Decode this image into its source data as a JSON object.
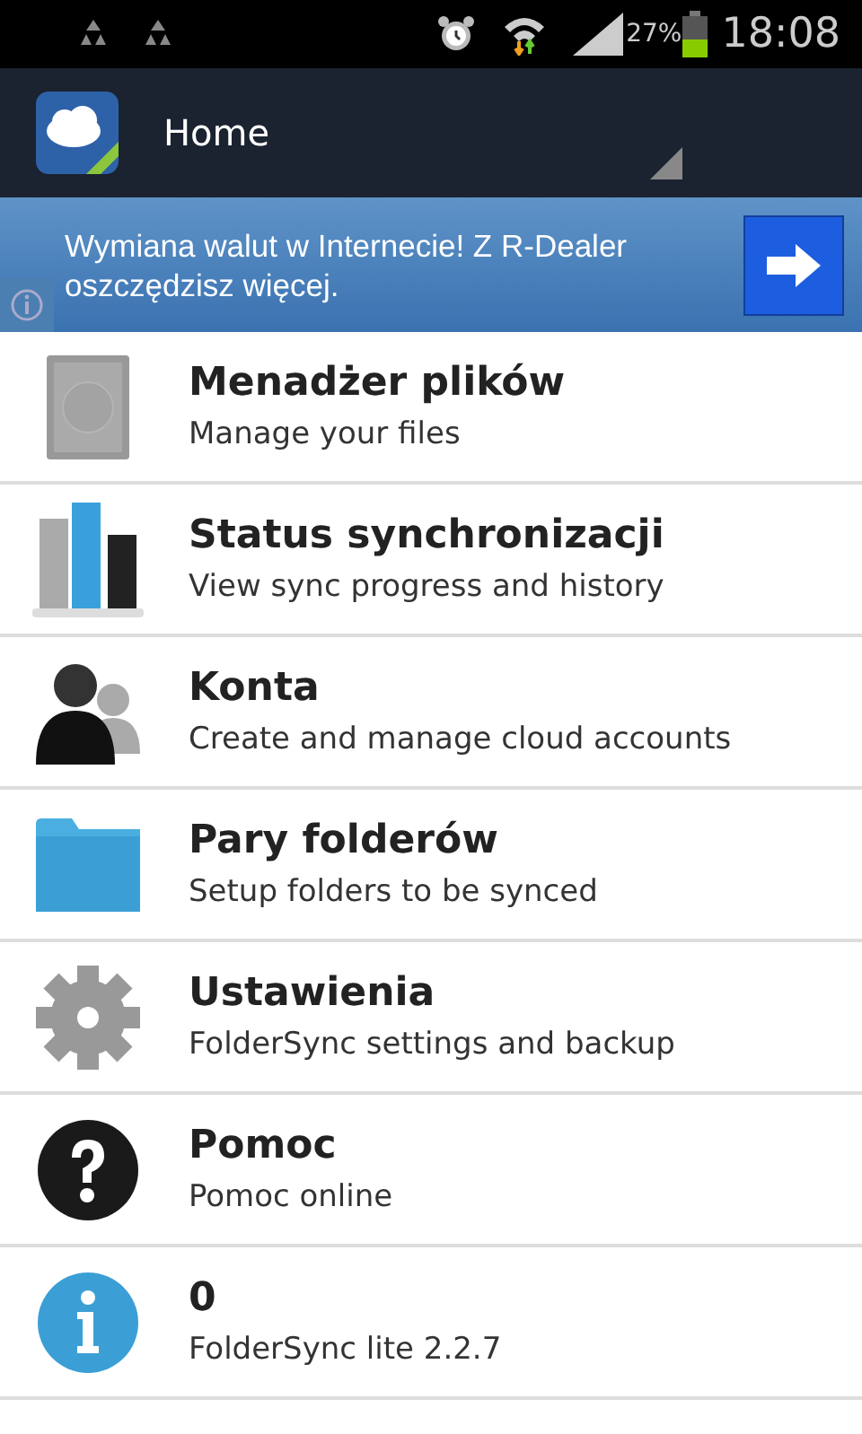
{
  "status_bar": {
    "battery_text": "27%",
    "time": "18:08"
  },
  "action_bar": {
    "title": "Home"
  },
  "ad": {
    "text": "Wymiana walut w Internecie! Z R-Dealer oszczędzisz więcej."
  },
  "menu": [
    {
      "kind": "drive",
      "title": "Menadżer plików",
      "subtitle": "Manage your files"
    },
    {
      "kind": "chart",
      "title": "Status synchronizacji",
      "subtitle": "View sync progress and history"
    },
    {
      "kind": "people",
      "title": "Konta",
      "subtitle": "Create and manage cloud accounts"
    },
    {
      "kind": "folder",
      "title": "Pary folderów",
      "subtitle": "Setup folders to be synced"
    },
    {
      "kind": "gear",
      "title": "Ustawienia",
      "subtitle": "FolderSync settings and backup"
    },
    {
      "kind": "help",
      "title": "Pomoc",
      "subtitle": "Pomoc online"
    },
    {
      "kind": "info",
      "title": "0",
      "subtitle": "FolderSync lite 2.2.7"
    }
  ]
}
